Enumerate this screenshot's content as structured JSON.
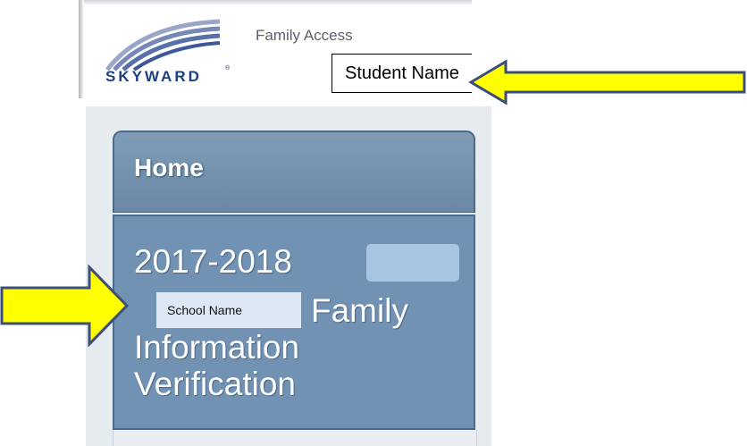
{
  "header": {
    "brand_text": "SKYWARD",
    "brand_reg": "®",
    "app_title": "Family Access",
    "student_label": "Student Name"
  },
  "sidebar": {
    "home_label": "Home",
    "item": {
      "year": "2017-2018",
      "school_label": "School Name",
      "word_family": "Family",
      "line_information": "Information",
      "line_verification": "Verification"
    }
  },
  "colors": {
    "tab_blue": "#7292b3",
    "tab_border": "#4d6a88",
    "arrow_yellow": "#ffff00",
    "arrow_outline": "#3b4f78",
    "brand_navy": "#1d3f80"
  }
}
